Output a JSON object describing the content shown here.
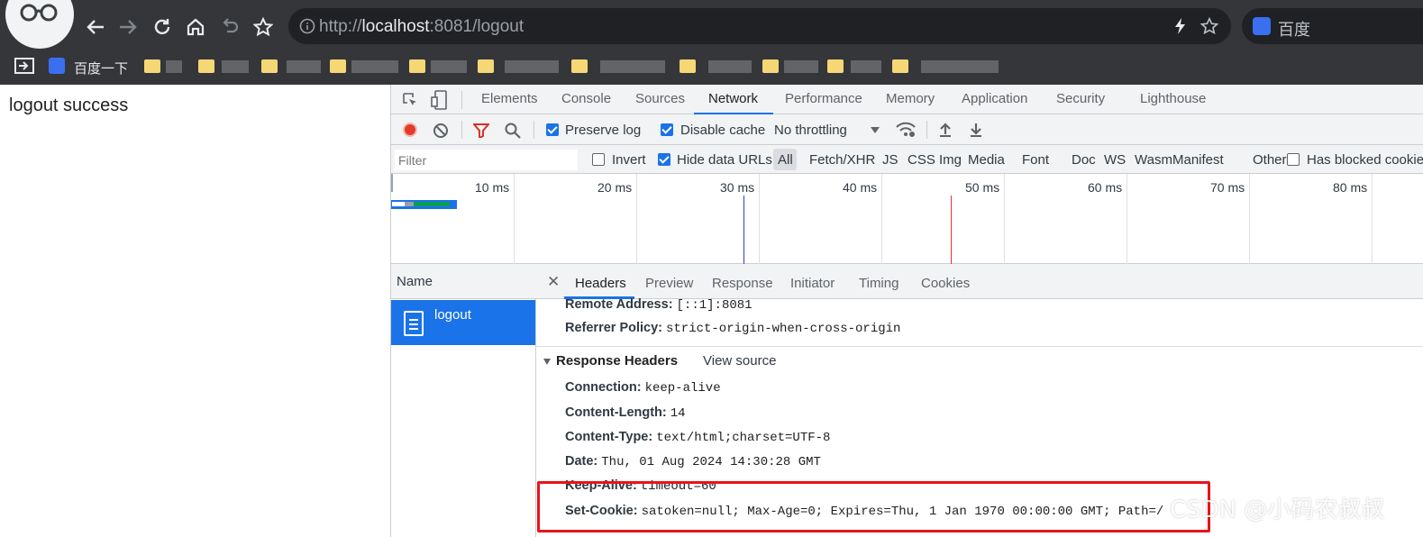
{
  "browser": {
    "url_scheme": "http://",
    "url_host": "localhost",
    "url_rest": ":8081/logout",
    "search_engine_label": "百度",
    "bookmark_label": "百度一下"
  },
  "page": {
    "body_text": "logout success"
  },
  "devtools": {
    "tabs": [
      "Elements",
      "Console",
      "Sources",
      "Network",
      "Performance",
      "Memory",
      "Application",
      "Security",
      "Lighthouse"
    ],
    "active_tab": "Network",
    "toolbar": {
      "preserve_log": "Preserve log",
      "disable_cache": "Disable cache",
      "throttling": "No throttling"
    },
    "filter": {
      "placeholder": "Filter",
      "invert": "Invert",
      "hide_data_urls": "Hide data URLs",
      "types": [
        "All",
        "Fetch/XHR",
        "JS",
        "CSS",
        "Img",
        "Media",
        "Font",
        "Doc",
        "WS",
        "Wasm",
        "Manifest",
        "Other"
      ],
      "has_blocked_cookies": "Has blocked cookies"
    },
    "timeline_ticks": [
      "10 ms",
      "20 ms",
      "30 ms",
      "40 ms",
      "50 ms",
      "60 ms",
      "70 ms",
      "80 ms"
    ],
    "colors": {
      "accent": "#1a73e8",
      "record": "#e33a2c",
      "dcl_line": "#3b3bd0",
      "load_line": "#e0343a",
      "highlight": "#e8141a"
    },
    "requests": {
      "header": "Name",
      "items": [
        "logout"
      ]
    },
    "details": {
      "tabs": [
        "Headers",
        "Preview",
        "Response",
        "Initiator",
        "Timing",
        "Cookies"
      ],
      "active_tab": "Headers",
      "general": [
        {
          "k": "Remote Address:",
          "v": "[::1]:8081"
        },
        {
          "k": "Referrer Policy:",
          "v": "strict-origin-when-cross-origin"
        }
      ],
      "response_headers_title": "Response Headers",
      "view_source": "View source",
      "response_headers": [
        {
          "k": "Connection:",
          "v": "keep-alive"
        },
        {
          "k": "Content-Length:",
          "v": "14"
        },
        {
          "k": "Content-Type:",
          "v": "text/html;charset=UTF-8"
        },
        {
          "k": "Date:",
          "v": "Thu, 01 Aug 2024 14:30:28 GMT"
        },
        {
          "k": "Keep-Alive:",
          "v": "timeout=60"
        },
        {
          "k": "Set-Cookie:",
          "v": "satoken=null; Max-Age=0; Expires=Thu, 1 Jan 1970 00:00:00 GMT; Path=/"
        }
      ]
    }
  },
  "watermark": "CSDN @小码农叔叔"
}
